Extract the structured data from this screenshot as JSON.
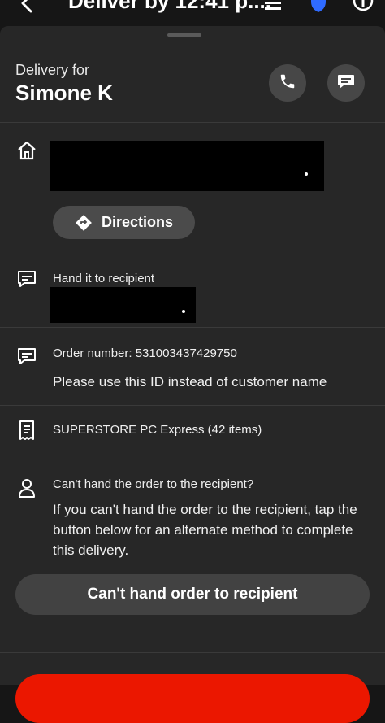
{
  "header": {
    "title": "Deliver by 12:41 p...."
  },
  "delivery": {
    "label": "Delivery for",
    "customer_name": "Simone K"
  },
  "directions": {
    "label": "Directions"
  },
  "handoff": {
    "label": "Hand it to recipient"
  },
  "order": {
    "number_text": "Order number: 531003437429750",
    "note": "Please use this ID instead of customer name"
  },
  "store": {
    "label": "SUPERSTORE PC Express (42 items)"
  },
  "cant_hand": {
    "question": "Can't hand the order to the recipient?",
    "description": "If you can't hand the order to the recipient, tap the button below for an alternate method to complete this delivery.",
    "button_label": "Can't hand order to recipient"
  },
  "colors": {
    "background": "#161616",
    "sheet": "#272727",
    "button": "#424242",
    "accent_red": "#eb1700"
  }
}
